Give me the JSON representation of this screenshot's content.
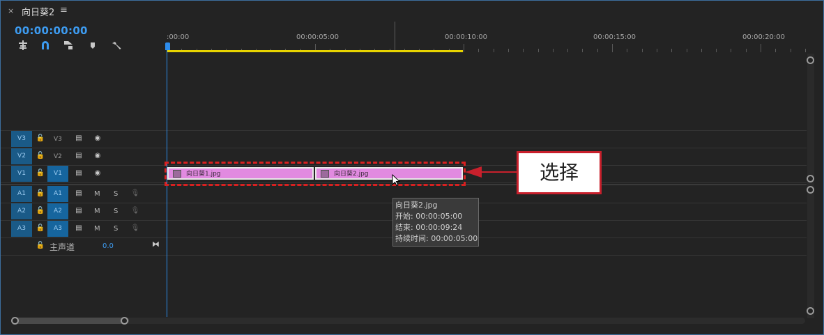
{
  "panel": {
    "close_glyph": "×",
    "sequence_name": "向日葵2",
    "menu_glyph": "≡",
    "timecode": "00:00:00:00"
  },
  "toolbar": {
    "icons": [
      "insert-sequence-as-nest-icon",
      "snap-icon",
      "linked-selection-icon",
      "add-marker-icon",
      "timeline-settings-wrench-icon"
    ]
  },
  "ruler": {
    "labels": [
      ":00:00",
      "00:00:05:00",
      "00:00:10:00",
      "00:00:15:00",
      "00:00:20:00"
    ]
  },
  "video_tracks": [
    {
      "source": "V3",
      "target": "V3"
    },
    {
      "source": "V2",
      "target": "V2"
    },
    {
      "source": "V1",
      "target": "V1"
    }
  ],
  "audio_tracks": [
    {
      "source": "A1",
      "target": "A1",
      "mute": "M",
      "solo": "S"
    },
    {
      "source": "A2",
      "target": "A2",
      "mute": "M",
      "solo": "S"
    },
    {
      "source": "A3",
      "target": "A3",
      "mute": "M",
      "solo": "S"
    }
  ],
  "master": {
    "label": "主声道",
    "value": "0.0"
  },
  "clips": [
    {
      "name": "向日葵1.jpg"
    },
    {
      "name": "向日葵2.jpg"
    }
  ],
  "tooltip": {
    "name": "向日葵2.jpg",
    "start": "开始: 00:00:05:00",
    "end": "结束: 00:00:09:24",
    "duration": "持续时间: 00:00:05:00"
  },
  "callout": {
    "text": "选择",
    "color": "#c8202c"
  },
  "colors": {
    "accent": "#2d8ceb",
    "clip": "#e18ae0",
    "work_area": "#e8d400",
    "track_button": "#1a5a87"
  }
}
